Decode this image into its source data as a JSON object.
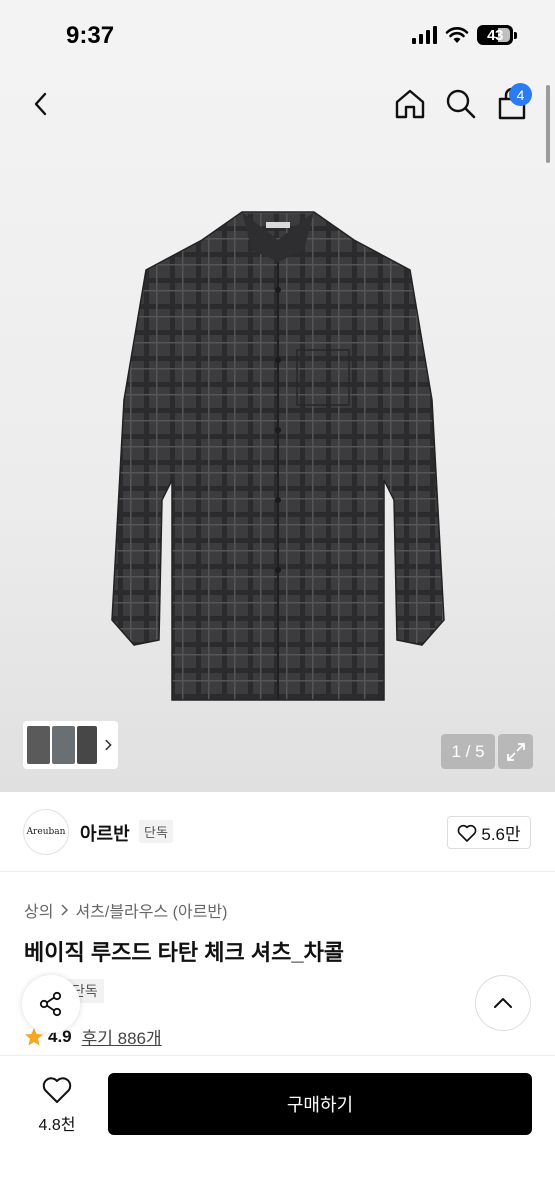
{
  "status_bar": {
    "time": "9:37",
    "battery": "43"
  },
  "header": {
    "cart_count": "4",
    "icons": [
      "back-icon",
      "home-icon",
      "search-icon",
      "cart-icon"
    ]
  },
  "gallery": {
    "page_counter": "1 / 5"
  },
  "brand": {
    "logo_text": "Areuban",
    "name": "아르반",
    "tag": "단독",
    "likes": "5.6만"
  },
  "product": {
    "breadcrumb": [
      "상의",
      "셔츠/블라우스 (아르반)"
    ],
    "title": "베이직 루즈드 타탄 체크 셔츠_차콜",
    "badge": "단독",
    "rating": "4.9",
    "reviews": "후기 886개"
  },
  "bottom_bar": {
    "wish_count": "4.8천",
    "buy_label": "구매하기"
  },
  "colors": {
    "accent_badge": "#2b7cf3",
    "buy_button": "#000000",
    "star": "#f5a623"
  }
}
